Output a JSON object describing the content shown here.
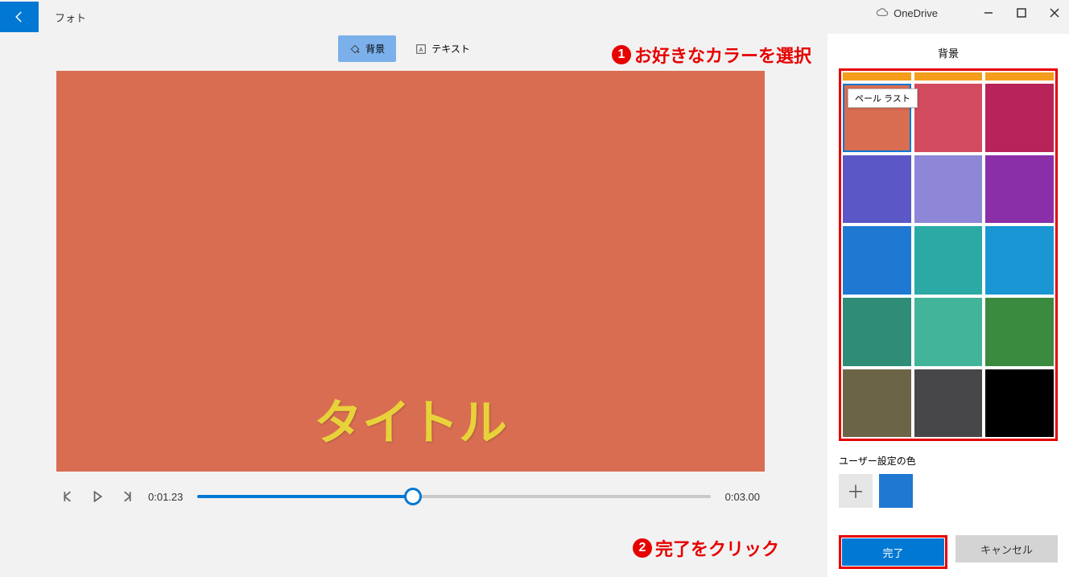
{
  "app": {
    "title": "フォト"
  },
  "onedrive": {
    "label": "OneDrive"
  },
  "tabs": {
    "background": "背景",
    "text": "テキスト"
  },
  "annotations": {
    "a1_num": "1",
    "a1_text": "お好きなカラーを選択",
    "a2_num": "2",
    "a2_text": "完了をクリック"
  },
  "preview": {
    "title_text": "タイトル"
  },
  "playback": {
    "current_time": "0:01.23",
    "total_time": "0:03.00"
  },
  "panel": {
    "title": "背景",
    "tooltip": "ペール ラスト",
    "custom_label": "ユーザー設定の色",
    "top_strip": [
      "#f59e1b",
      "#f59e1b",
      "#f59e1b"
    ],
    "swatches": [
      "#d96d52",
      "#d24b5e",
      "#b8235a",
      "#5b57c7",
      "#8e86d6",
      "#8a2fa8",
      "#1f78d1",
      "#2aa9a5",
      "#1996d3",
      "#2e8c77",
      "#41b49a",
      "#3a8a3f",
      "#6b6447",
      "#47474a",
      "#000000"
    ],
    "custom_color": "#1f78d1",
    "done": "完了",
    "cancel": "キャンセル"
  }
}
